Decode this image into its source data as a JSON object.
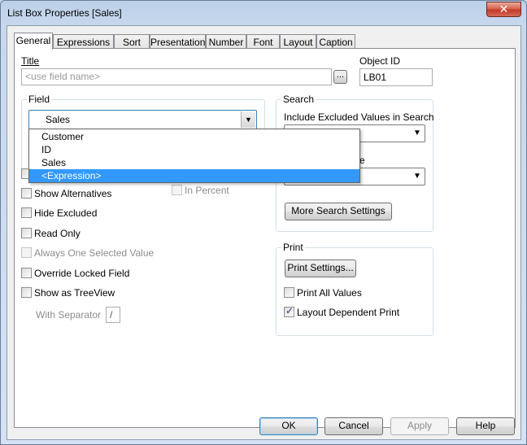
{
  "window": {
    "title": "List Box Properties [Sales]",
    "close_glyph": "✕"
  },
  "tabs": [
    "General",
    "Expressions",
    "Sort",
    "Presentation",
    "Number",
    "Font",
    "Layout",
    "Caption"
  ],
  "general": {
    "title_label": "Title",
    "title_placeholder": "<use field name>",
    "browse_label": "...",
    "object_id_label": "Object ID",
    "object_id_value": "LB01",
    "field_group": "Field",
    "field_value": "Sales",
    "field_options": [
      "Customer",
      "ID",
      "Sales",
      "<Expression>"
    ],
    "checkboxes": {
      "show_alternatives": "Show Alternatives",
      "hide_excluded": "Hide Excluded",
      "read_only": "Read Only",
      "always_one_selected": "Always One Selected Value",
      "override_locked": "Override Locked Field",
      "show_as_treeview": "Show as TreeView",
      "in_percent": "In Percent"
    },
    "with_separator_label": "With Separator",
    "separator_value": "/",
    "search_group": "Search",
    "include_excluded_label": "Include Excluded Values in Search",
    "search_mode_label_fragment": "e",
    "more_search_settings": "More Search Settings",
    "print_group": "Print",
    "print_settings": "Print Settings...",
    "print_all_values": "Print All Values",
    "layout_dependent_print": "Layout Dependent Print"
  },
  "footer": {
    "ok": "OK",
    "cancel": "Cancel",
    "apply": "Apply",
    "help": "Help"
  }
}
